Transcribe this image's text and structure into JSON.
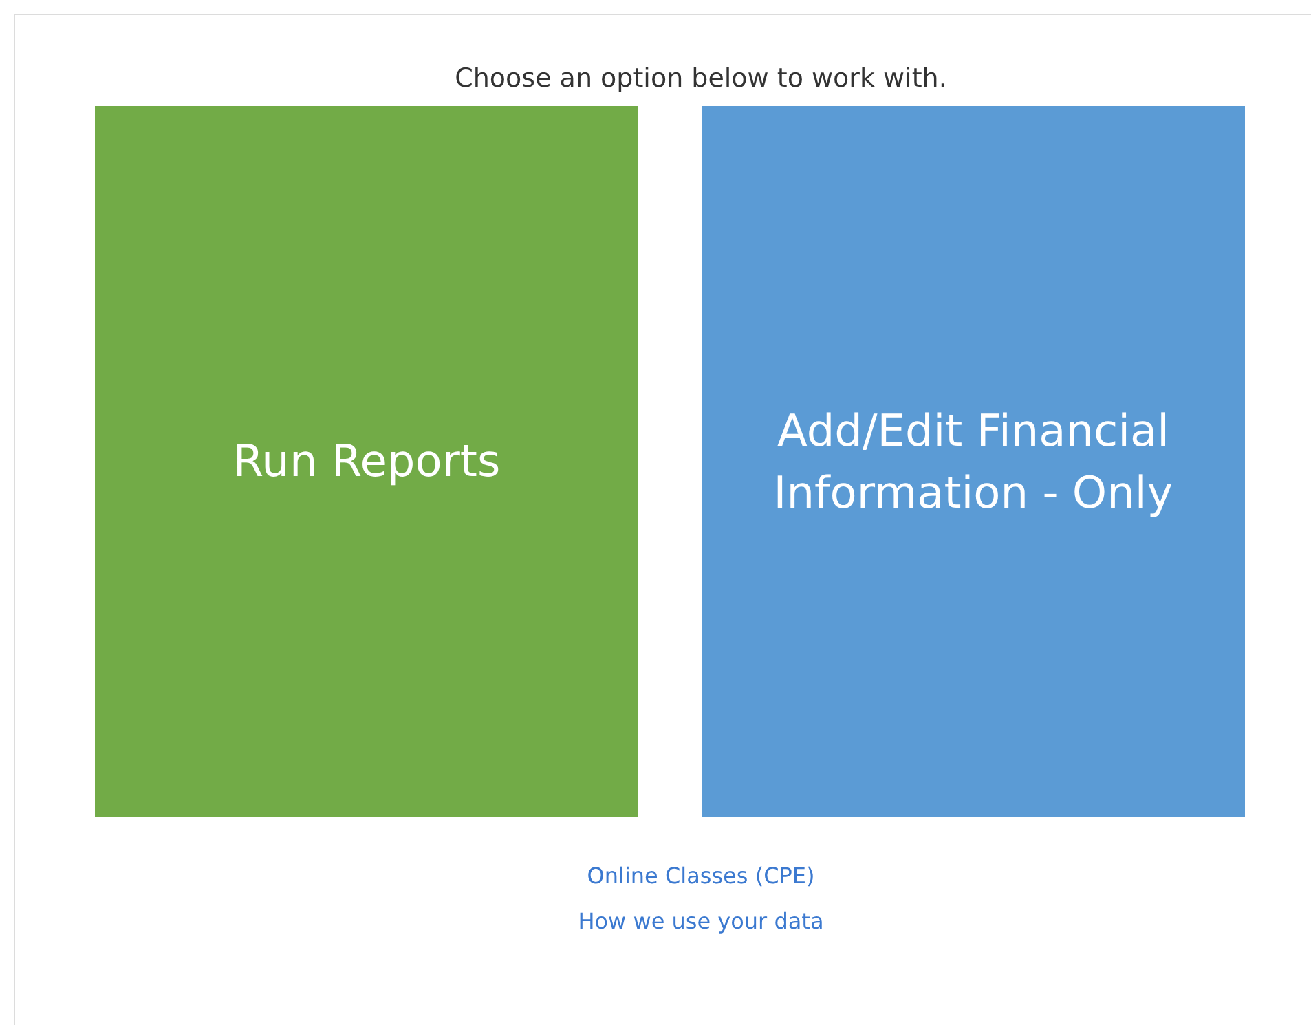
{
  "heading": "Choose an option below to work with.",
  "options": [
    {
      "label": "Run Reports",
      "color": "#72ab47"
    },
    {
      "label": "Add/Edit Financial Information - Only",
      "color": "#5b9bd5"
    }
  ],
  "links": [
    "Online Classes (CPE)",
    "How we use your data"
  ]
}
